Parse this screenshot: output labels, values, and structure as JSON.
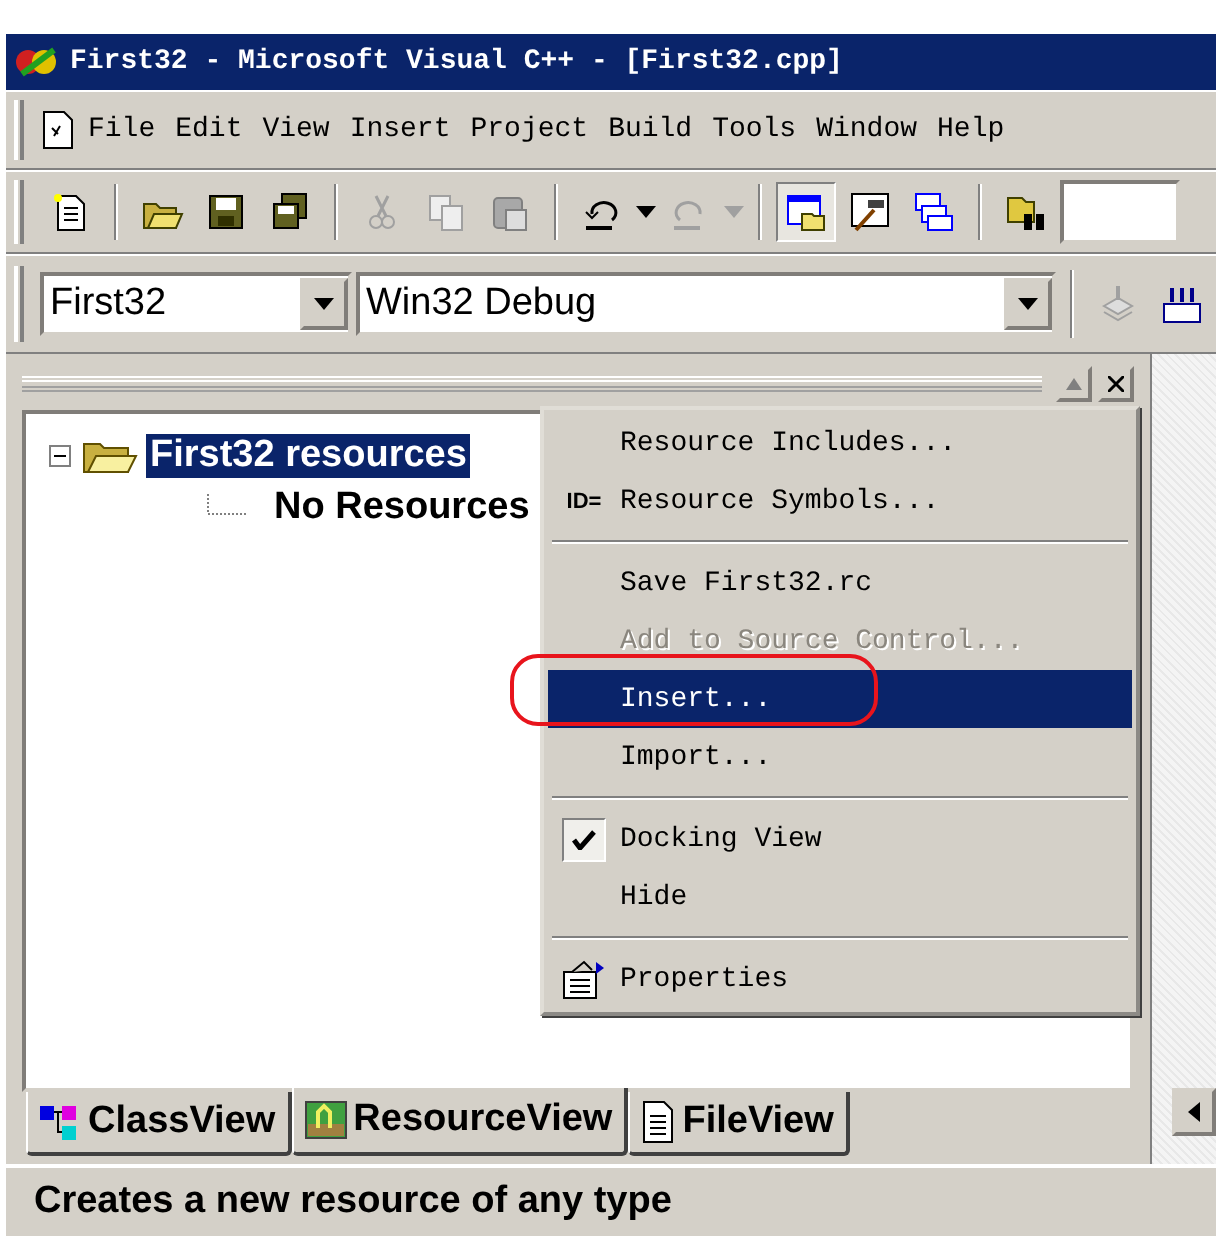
{
  "window": {
    "title": "First32 - Microsoft Visual C++ - [First32.cpp]"
  },
  "menu_bar": [
    "File",
    "Edit",
    "View",
    "Insert",
    "Project",
    "Build",
    "Tools",
    "Window",
    "Help"
  ],
  "toolbar_combos": [
    {
      "value": "First32"
    },
    {
      "value": "Win32 Debug"
    }
  ],
  "tree": [
    {
      "label": "First32 resources",
      "selected": true,
      "expanded": true,
      "children": [
        {
          "label": "No Resources",
          "selected": false
        }
      ]
    }
  ],
  "context_menu": [
    {
      "kind": "item",
      "label": "Resource Includes...",
      "disabled": false,
      "selected": false,
      "checked": false
    },
    {
      "kind": "item",
      "label": "Resource Symbols...",
      "icon_text": "ID=",
      "disabled": false,
      "selected": false,
      "checked": false
    },
    {
      "kind": "separator"
    },
    {
      "kind": "item",
      "label": "Save First32.rc",
      "disabled": false,
      "selected": false,
      "checked": false
    },
    {
      "kind": "item",
      "label": "Add to Source Control...",
      "disabled": true,
      "selected": false,
      "checked": false
    },
    {
      "kind": "item",
      "label": "Insert...",
      "disabled": false,
      "selected": true,
      "checked": false
    },
    {
      "kind": "item",
      "label": "Import...",
      "disabled": false,
      "selected": false,
      "checked": false
    },
    {
      "kind": "separator"
    },
    {
      "kind": "item",
      "label": "Docking View",
      "disabled": false,
      "selected": false,
      "checked": true
    },
    {
      "kind": "item",
      "label": "Hide",
      "disabled": false,
      "selected": false,
      "checked": false
    },
    {
      "kind": "separator"
    },
    {
      "kind": "icon_item",
      "label": "Properties",
      "disabled": false,
      "selected": false,
      "checked": false
    }
  ],
  "tabs": [
    {
      "label": "ClassView",
      "selected": false
    },
    {
      "label": "ResourceView",
      "selected": true
    },
    {
      "label": "FileView",
      "selected": false
    }
  ],
  "status_bar": {
    "text": "Creates a new resource of any type"
  }
}
